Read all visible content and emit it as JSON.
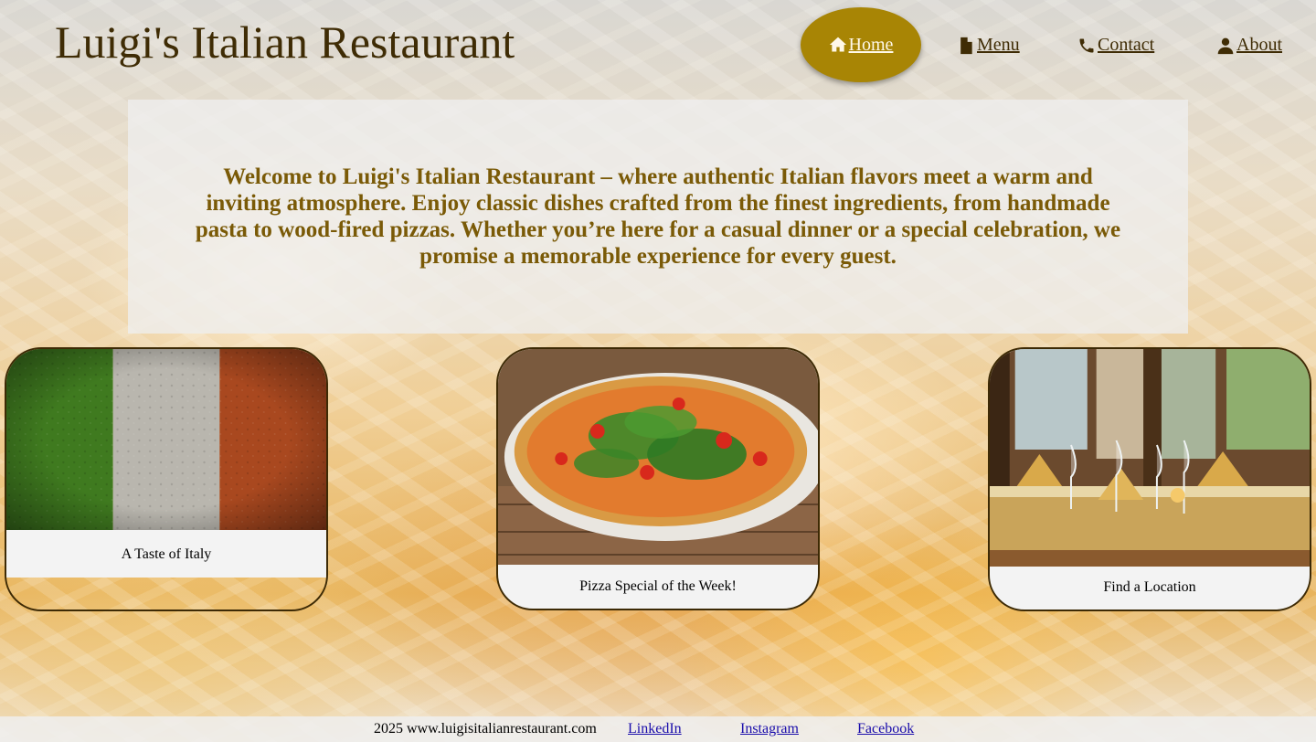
{
  "header": {
    "title": "Luigi's Italian Restaurant"
  },
  "nav": {
    "items": [
      {
        "label": "Home",
        "icon": "home-icon",
        "active": true
      },
      {
        "label": "Menu",
        "icon": "file-icon",
        "active": false
      },
      {
        "label": "Contact",
        "icon": "phone-icon",
        "active": false
      },
      {
        "label": "About",
        "icon": "user-icon",
        "active": false
      }
    ]
  },
  "welcome": {
    "text": "Welcome to Luigi's Italian Restaurant – where authentic Italian flavors meet a warm and inviting atmosphere. Enjoy classic dishes crafted from the finest ingredients, from handmade pasta to wood-fired pizzas. Whether you’re here for a casual dinner or a special celebration, we promise a memorable experience for every guest."
  },
  "cards": [
    {
      "caption": "A Taste of Italy",
      "image": "italian-flag-image"
    },
    {
      "caption": "Pizza Special of the Week!",
      "image": "pizza-image"
    },
    {
      "caption": "Find a Location",
      "image": "restaurant-dining-image"
    }
  ],
  "footer": {
    "copyright": "2025 www.luigisitalianrestaurant.com",
    "links": [
      "LinkedIn",
      "Instagram",
      "Facebook"
    ]
  },
  "colors": {
    "brand_brown": "#3f2c05",
    "accent_gold": "#a88505",
    "welcome_text": "#7a5a07"
  }
}
